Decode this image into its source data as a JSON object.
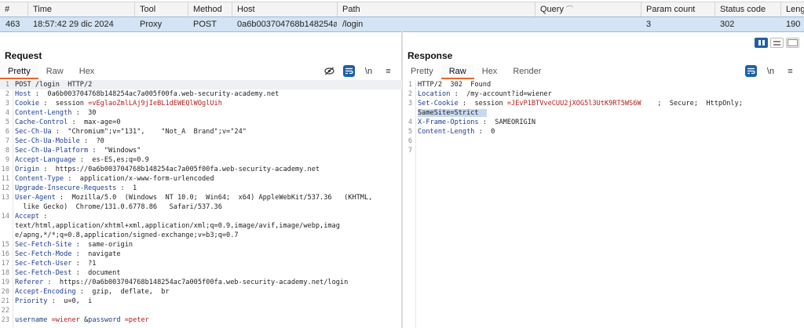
{
  "history": {
    "columns": [
      "#",
      "Time",
      "Tool",
      "Method",
      "Host",
      "Path",
      "Query",
      "Param count",
      "Status code",
      "Lengt"
    ],
    "row": {
      "num": "463",
      "time": "18:57:42 29 dic 2024",
      "tool": "Proxy",
      "method": "POST",
      "host": "0a6b003704768b148254ac7a...",
      "path": "/login",
      "query": "",
      "param_count": "3",
      "status": "302",
      "length": "190"
    }
  },
  "request": {
    "title": "Request",
    "tabs": [
      "Pretty",
      "Raw",
      "Hex"
    ],
    "active_tab": "Pretty",
    "newline_label": "\\n",
    "menu_label": "≡"
  },
  "response": {
    "title": "Response",
    "tabs": [
      "Pretty",
      "Raw",
      "Hex",
      "Render"
    ],
    "active_tab": "Raw",
    "newline_label": "\\n",
    "menu_label": "≡"
  },
  "request_lines": [
    [
      [
        "POST /login  HTTP/2",
        ""
      ]
    ],
    [
      [
        "Host",
        "hn"
      ],
      [
        " :  0a6b003704768b148254ac7a005f00fa.web-security-academy.net",
        ""
      ]
    ],
    [
      [
        "Cookie",
        "hn"
      ],
      [
        " :  session ",
        ""
      ],
      [
        "=vEglaoZmlLAj9jIeBL1dEWEQlWOglUih",
        "red"
      ]
    ],
    [
      [
        "Content-Length",
        "hn"
      ],
      [
        " :  30",
        ""
      ]
    ],
    [
      [
        "Cache-Control",
        "hn"
      ],
      [
        " :  max-age=0",
        ""
      ]
    ],
    [
      [
        "Sec-Ch-Ua",
        "hn"
      ],
      [
        " :  \"Chromium\";v=\"131\",    \"Not_A  Brand\";v=\"24\"",
        ""
      ]
    ],
    [
      [
        "Sec-Ch-Ua-Mobile",
        "hn"
      ],
      [
        " :  ?0",
        ""
      ]
    ],
    [
      [
        "Sec-Ch-Ua-Platform",
        "hn"
      ],
      [
        " :  \"Windows\"",
        ""
      ]
    ],
    [
      [
        "Accept-Language",
        "hn"
      ],
      [
        " :  es-ES,es;q=0.9",
        ""
      ]
    ],
    [
      [
        "Origin",
        "hn"
      ],
      [
        " :  https://0a6b003704768b148254ac7a005f00fa.web-security-academy.net",
        ""
      ]
    ],
    [
      [
        "Content-Type",
        "hn"
      ],
      [
        " :  application/x-www-form-urlencoded",
        ""
      ]
    ],
    [
      [
        "Upgrade-Insecure-Requests",
        "hn"
      ],
      [
        " :  1",
        ""
      ]
    ],
    [
      [
        "User-Agent",
        "hn"
      ],
      [
        " :  Mozilla/5.0  (Windows  NT 10.0;  Win64;  x64) AppleWebKit/537.36   (KHTML,",
        ""
      ]
    ],
    [
      [
        "  like Gecko)  Chrome/131.0.6778.86   Safari/537.36",
        ""
      ]
    ],
    [
      [
        "Accept",
        "hn"
      ],
      [
        " :",
        ""
      ]
    ],
    [
      [
        "text/html,application/xhtml+xml,application/xml;q=0.9,image/avif,image/webp,imag",
        ""
      ]
    ],
    [
      [
        "e/apng,*/*;q=0.8,application/signed-exchange;v=b3;q=0.7",
        ""
      ]
    ],
    [
      [
        "Sec-Fetch-Site",
        "hn"
      ],
      [
        " :  same-origin",
        ""
      ]
    ],
    [
      [
        "Sec-Fetch-Mode",
        "hn"
      ],
      [
        " :  navigate",
        ""
      ]
    ],
    [
      [
        "Sec-Fetch-User",
        "hn"
      ],
      [
        " :  ?1",
        ""
      ]
    ],
    [
      [
        "Sec-Fetch-Dest",
        "hn"
      ],
      [
        " :  document",
        ""
      ]
    ],
    [
      [
        "Referer",
        "hn"
      ],
      [
        " :  https://0a6b003704768b148254ac7a005f00fa.web-security-academy.net/login",
        ""
      ]
    ],
    [
      [
        "Accept-Encoding",
        "hn"
      ],
      [
        " :  gzip,  deflate,  br",
        ""
      ]
    ],
    [
      [
        "Priority",
        "hn"
      ],
      [
        " :  u=0,  i",
        ""
      ]
    ],
    [
      [
        "",
        ""
      ]
    ],
    [
      [
        "username ",
        "hn"
      ],
      [
        "=wiener ",
        "red"
      ],
      [
        "&",
        "val"
      ],
      [
        "password ",
        "hn"
      ],
      [
        "=peter",
        "red"
      ]
    ]
  ],
  "request_line_numbers": [
    "1",
    "2",
    "3",
    "4",
    "5",
    "6",
    "7",
    "8",
    "9",
    "10",
    "11",
    "12",
    "13",
    "",
    "14",
    "",
    "",
    "15",
    "16",
    "17",
    "18",
    "19",
    "20",
    "21",
    "22",
    "23"
  ],
  "response_lines": [
    [
      [
        "HTTP/2  302  Found",
        ""
      ]
    ],
    [
      [
        "Location",
        "hn"
      ],
      [
        " :  /my-account?id=wiener",
        ""
      ]
    ],
    [
      [
        "Set-Cookie",
        "hn"
      ],
      [
        " :  session ",
        ""
      ],
      [
        "=JEvP1BTVveCUU2jXOG5l3UtK9RT5WS6W",
        "red"
      ],
      [
        "    ;  Secure;  HttpOnly;",
        ""
      ]
    ],
    [
      [
        "SameSite=Strict  ",
        "hl"
      ]
    ],
    [
      [
        "X-Frame-Options",
        "hn"
      ],
      [
        " :  SAMEORIGIN",
        ""
      ]
    ],
    [
      [
        "Content-Length",
        "hn"
      ],
      [
        " :  0",
        ""
      ]
    ],
    [
      [
        "",
        ""
      ]
    ],
    [
      [
        "",
        ""
      ]
    ]
  ],
  "response_line_numbers": [
    "1",
    "2",
    "3",
    "",
    "4",
    "5",
    "6",
    "7"
  ]
}
